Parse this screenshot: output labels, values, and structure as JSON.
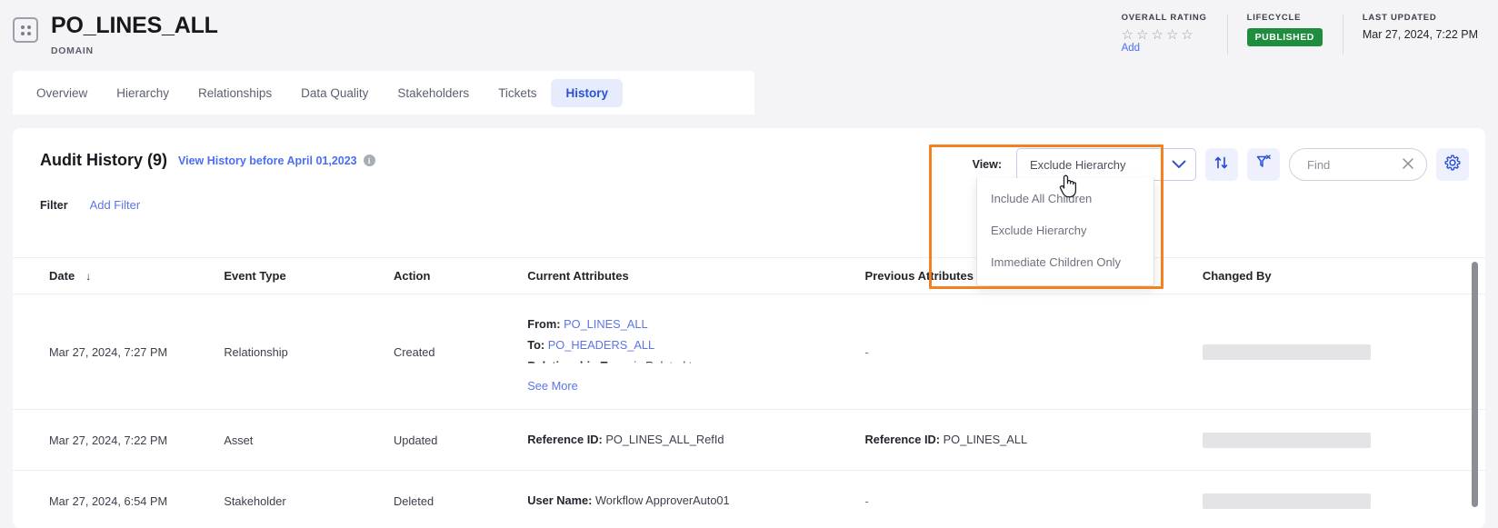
{
  "header": {
    "asset_title": "PO_LINES_ALL",
    "asset_subtype": "DOMAIN",
    "domain_icon": "grid-dots-icon",
    "meta": {
      "rating_label": "OVERALL RATING",
      "rating_stars": 5,
      "rating_filled": 0,
      "rating_add_label": "Add",
      "lifecycle_label": "LIFECYCLE",
      "lifecycle_value": "PUBLISHED",
      "lifecycle_color": "#1e8e3e",
      "last_updated_label": "LAST UPDATED",
      "last_updated_value": "Mar 27, 2024, 7:22 PM"
    }
  },
  "tabs": [
    {
      "label": "Overview",
      "active": false
    },
    {
      "label": "Hierarchy",
      "active": false
    },
    {
      "label": "Relationships",
      "active": false
    },
    {
      "label": "Data Quality",
      "active": false
    },
    {
      "label": "Stakeholders",
      "active": false
    },
    {
      "label": "Tickets",
      "active": false
    },
    {
      "label": "History",
      "active": true
    }
  ],
  "audit": {
    "title": "Audit History (9)",
    "view_history_link": "View History before April 01,2023",
    "info_icon": "info-icon",
    "filter_label": "Filter",
    "add_filter_label": "Add Filter"
  },
  "toolbar": {
    "view_label": "View:",
    "view_selected": "Exclude Hierarchy",
    "view_options": [
      "Include All Children",
      "Exclude Hierarchy",
      "Immediate Children Only"
    ],
    "sort_icon": "sort-arrows-icon",
    "filter_clear_icon": "filter-remove-icon",
    "find_value": "",
    "find_placeholder": "Find",
    "find_clear_icon": "close-icon",
    "settings_icon": "gear-icon",
    "accent_color": "#3456c8",
    "highlight_color": "#f4811f"
  },
  "table": {
    "columns": [
      "Date",
      "Event Type",
      "Action",
      "Current Attributes",
      "Previous Attributes",
      "Changed By"
    ],
    "sort_column": "Date",
    "sort_direction": "desc",
    "rows": [
      {
        "date": "Mar 27, 2024, 7:27 PM",
        "event_type": "Relationship",
        "action": "Created",
        "current_attributes": [
          {
            "key": "From:",
            "value": "PO_LINES_ALL",
            "link": true
          },
          {
            "key": "To:",
            "value": "PO_HEADERS_ALL",
            "link": true
          },
          {
            "key": "Relationship Type:",
            "value": "is Related to",
            "link": false,
            "clipped": true
          }
        ],
        "see_more": "See More",
        "previous_attributes": "-",
        "changed_by": "",
        "changed_by_redacted": true
      },
      {
        "date": "Mar 27, 2024, 7:22 PM",
        "event_type": "Asset",
        "action": "Updated",
        "current_attributes": [
          {
            "key": "Reference ID:",
            "value": "PO_LINES_ALL_RefId",
            "link": false
          }
        ],
        "previous_attributes_rich": [
          {
            "key": "Reference ID:",
            "value": "PO_LINES_ALL"
          }
        ],
        "changed_by": "",
        "changed_by_redacted": true
      },
      {
        "date": "Mar 27, 2024, 6:54 PM",
        "event_type": "Stakeholder",
        "action": "Deleted",
        "current_attributes": [
          {
            "key": "User Name:",
            "value": "Workflow ApproverAuto01",
            "link": false
          }
        ],
        "previous_attributes": "-",
        "changed_by": "",
        "changed_by_redacted": true
      }
    ]
  }
}
